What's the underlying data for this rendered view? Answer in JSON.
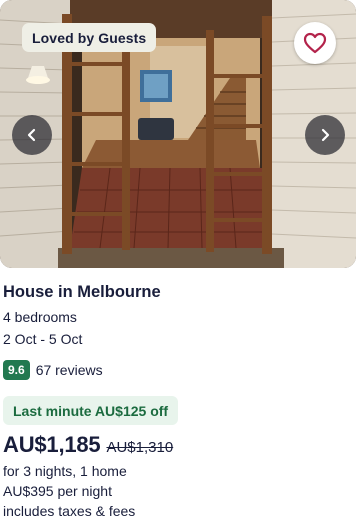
{
  "listing": {
    "badge": "Loved by Guests",
    "title": "House in Melbourne",
    "bedrooms": "4 bedrooms",
    "dates": "2 Oct - 5 Oct",
    "rating_score": "9.6",
    "reviews": "67 reviews",
    "deal_text": "Last minute AU$125 off",
    "price": "AU$1,185",
    "old_price": "AU$1,310",
    "stay_summary": "for 3 nights, 1 home",
    "per_night": "AU$395 per night",
    "taxes_note": "includes taxes & fees"
  },
  "colors": {
    "rating_badge": "#227950",
    "deal_background": "#e8f4ec",
    "deal_text": "#1b6b3f",
    "heart": "#b3234b",
    "text": "#191e3b"
  },
  "icons": {
    "favorite": "heart-outline-icon",
    "previous": "chevron-left-icon",
    "next": "chevron-right-icon"
  }
}
